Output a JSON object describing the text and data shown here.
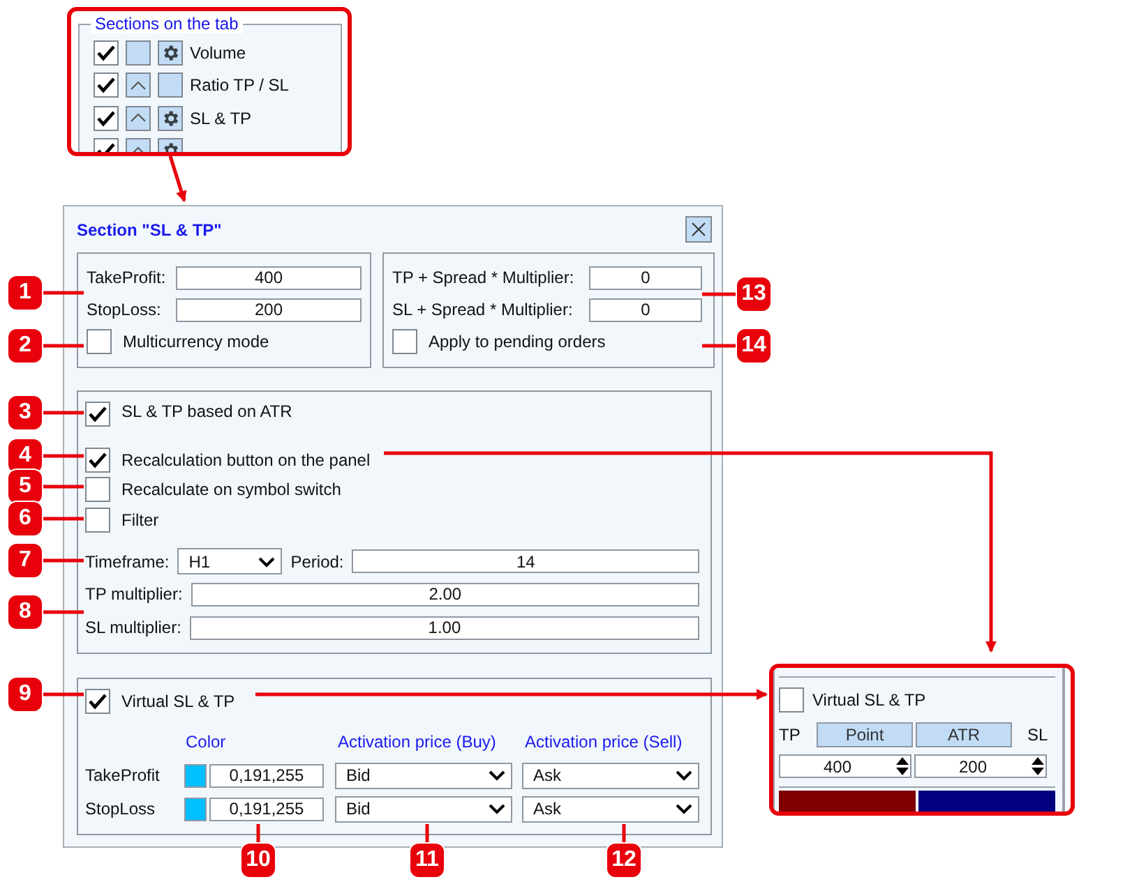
{
  "sections_inset": {
    "title": "Sections on the tab",
    "items": [
      {
        "label": "Volume",
        "checked": true,
        "arrow": false,
        "gear": true
      },
      {
        "label": "Ratio TP / SL",
        "checked": true,
        "arrow": true,
        "gear": false
      },
      {
        "label": "SL & TP",
        "checked": true,
        "arrow": true,
        "gear": true
      },
      {
        "checked": true,
        "arrow": true,
        "gear": true
      }
    ]
  },
  "dialog": {
    "title": "Section \"SL & TP\"",
    "levels": {
      "take_profit": {
        "label": "TakeProfit:",
        "value": "400"
      },
      "stop_loss": {
        "label": "StopLoss:",
        "value": "200"
      },
      "multicurrency": {
        "label": "Multicurrency mode",
        "checked": false
      }
    },
    "spread": {
      "tp": {
        "label": "TP + Spread * Multiplier:",
        "value": "0"
      },
      "sl": {
        "label": "SL + Spread * Multiplier:",
        "value": "0"
      },
      "pending": {
        "label": "Apply to pending orders",
        "checked": false
      }
    },
    "atr": {
      "options": [
        {
          "label": "SL & TP based on ATR",
          "checked": true
        },
        {
          "label": "Recalculation button on the panel",
          "checked": true
        },
        {
          "label": "Recalculate on symbol switch",
          "checked": false
        },
        {
          "label": "Filter",
          "checked": false
        }
      ],
      "timeframe": {
        "label": "Timeframe:",
        "value": "H1"
      },
      "period": {
        "label": "Period:",
        "value": "14"
      },
      "multipliers": [
        {
          "label": "TP multiplier:",
          "value": "2.00"
        },
        {
          "label": "SL multiplier:",
          "value": "1.00"
        }
      ]
    },
    "virtual": {
      "label": "Virtual SL & TP",
      "checked": true,
      "columns": [
        "Color",
        "Activation price (Buy)",
        "Activation price (Sell)"
      ],
      "rows": [
        {
          "label": "TakeProfit",
          "color": "#00bfff",
          "color_text": "0,191,255",
          "buy": "Bid",
          "sell": "Ask"
        },
        {
          "label": "StopLoss",
          "color": "#00bfff",
          "color_text": "0,191,255",
          "buy": "Bid",
          "sell": "Ask"
        }
      ]
    }
  },
  "panel_inset": {
    "label": "Virtual SL & TP",
    "checked": false,
    "tp_label": "TP",
    "sl_label": "SL",
    "modes": [
      "Point",
      "ATR"
    ],
    "values": [
      "400",
      "200"
    ],
    "buttons": [
      {
        "color": "#800000"
      },
      {
        "color": "#000080"
      }
    ]
  },
  "callouts": [
    "1",
    "2",
    "3",
    "4",
    "5",
    "6",
    "7",
    "8",
    "9",
    "10",
    "11",
    "12",
    "13",
    "14"
  ]
}
